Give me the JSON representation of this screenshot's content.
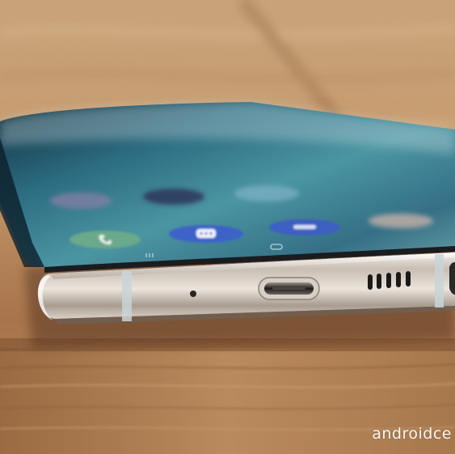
{
  "photo": {
    "subject": "smartphone-bottom-edge",
    "surface": "wooden-table",
    "watermark_text": "androidce",
    "icons": [
      "phone-app-icon",
      "messages-app-icon",
      "contacts-app-icon",
      "internet-app-icon",
      "camera-app-icon",
      "home-gesture-icon",
      "recents-gesture-icon"
    ]
  },
  "colors": {
    "wood_light": "#d6ab7c",
    "wood_dark": "#8c5e38",
    "screen_teal": "#3e8a99",
    "screen_dark": "#0f2b3a",
    "chrome_light": "#eae4dc",
    "chrome_dark": "#8d8379",
    "app_blue": "#3d64c8",
    "app_green": "#6aa98a"
  }
}
